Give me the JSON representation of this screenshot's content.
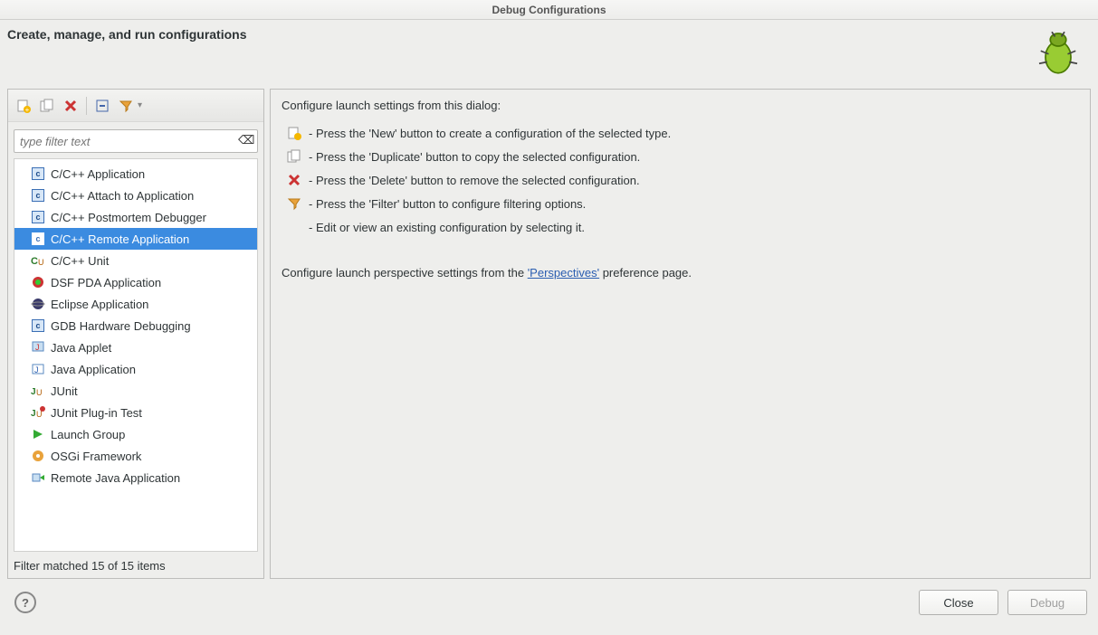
{
  "window": {
    "title": "Debug Configurations"
  },
  "header": {
    "title": "Create, manage, and run configurations"
  },
  "filter": {
    "placeholder": "type filter text"
  },
  "tree": {
    "items": [
      {
        "label": "C/C++ Application",
        "icon": "c"
      },
      {
        "label": "C/C++ Attach to Application",
        "icon": "c"
      },
      {
        "label": "C/C++ Postmortem Debugger",
        "icon": "c"
      },
      {
        "label": "C/C++ Remote Application",
        "icon": "c",
        "selected": true
      },
      {
        "label": "C/C++ Unit",
        "icon": "cu"
      },
      {
        "label": "DSF PDA Application",
        "icon": "dsf"
      },
      {
        "label": "Eclipse Application",
        "icon": "eclipse"
      },
      {
        "label": "GDB Hardware Debugging",
        "icon": "c"
      },
      {
        "label": "Java Applet",
        "icon": "japplet"
      },
      {
        "label": "Java Application",
        "icon": "japp"
      },
      {
        "label": "JUnit",
        "icon": "junit"
      },
      {
        "label": "JUnit Plug-in Test",
        "icon": "junitp"
      },
      {
        "label": "Launch Group",
        "icon": "launch"
      },
      {
        "label": "OSGi Framework",
        "icon": "osgi"
      },
      {
        "label": "Remote Java Application",
        "icon": "remote"
      }
    ],
    "status": "Filter matched 15 of 15 items"
  },
  "help": {
    "intro": "Configure launch settings from this dialog:",
    "rows": [
      {
        "icon": "new",
        "text": " - Press the 'New' button to create a configuration of the selected type."
      },
      {
        "icon": "duplicate",
        "text": " - Press the 'Duplicate' button to copy the selected configuration."
      },
      {
        "icon": "delete",
        "text": " - Press the 'Delete' button to remove the selected configuration."
      },
      {
        "icon": "filter",
        "text": " - Press the 'Filter' button to configure filtering options."
      },
      {
        "icon": "",
        "text": " - Edit or view an existing configuration by selecting it."
      }
    ],
    "perspectives_pre": "Configure launch perspective settings from the ",
    "perspectives_link": "'Perspectives'",
    "perspectives_post": " preference page."
  },
  "buttons": {
    "close": "Close",
    "debug": "Debug"
  }
}
